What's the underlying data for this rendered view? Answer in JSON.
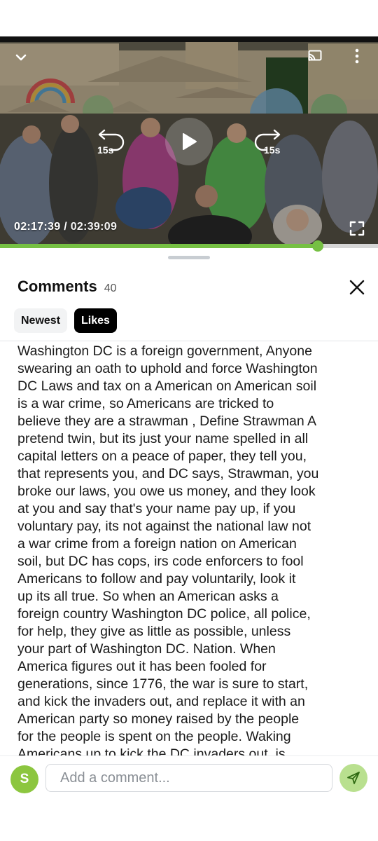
{
  "video": {
    "current_time": "02:17:39",
    "separator": " / ",
    "duration": "02:39:09",
    "progress_fraction": 0.84,
    "rewind_label": "15s",
    "forward_label": "15s",
    "icons": {
      "collapse": "chevron-down-icon",
      "cast": "cast-icon",
      "menu": "more-vertical-icon",
      "rewind": "rewind-15-icon",
      "play": "play-icon",
      "forward": "forward-15-icon",
      "fullscreen": "fullscreen-icon"
    },
    "accent_color": "#76c043"
  },
  "comments": {
    "title": "Comments",
    "count": "40",
    "sort_tabs": [
      {
        "label": "Newest",
        "active": false
      },
      {
        "label": "Likes",
        "active": true
      }
    ],
    "comment_lines": [
      "Washington DC is a foreign government,  Anyone",
      "swearing an oath to uphold and force Washington",
      "DC Laws and tax on a American on American soil",
      "is a war crime, so Americans are tricked to",
      "believe they are a strawman , Define Strawman A",
      "pretend twin, but its just your name spelled in all",
      "capital letters on a peace of paper, they tell you,",
      "that represents you, and DC says, Strawman, you",
      "broke our laws, you owe us money, and they look",
      "at you and say that's your name pay up, if you",
      "voluntary pay, its not against the national law not",
      "a war crime from a foreign nation on American",
      "soil, but DC has cops, irs code enforcers to fool",
      "Americans to follow and pay voluntarily,  look it",
      "up its all true. So when an American asks a",
      "foreign country Washington DC police, all police,",
      "for help, they give as little as possible, unless",
      "your part of Washington DC. Nation. When",
      "America figures out it has been fooled for",
      "generations, since 1776, the war is sure to start,",
      "and kick the invaders out, and replace it with an",
      "American party so money raised by the people",
      "for the people is spent on the people. Waking",
      "Americans up to kick the DC invaders out, is"
    ]
  },
  "compose": {
    "avatar_initial": "S",
    "avatar_color": "#8cc63f",
    "placeholder": "Add a comment...",
    "send_icon": "send-icon",
    "send_color": "#b9e08f"
  }
}
